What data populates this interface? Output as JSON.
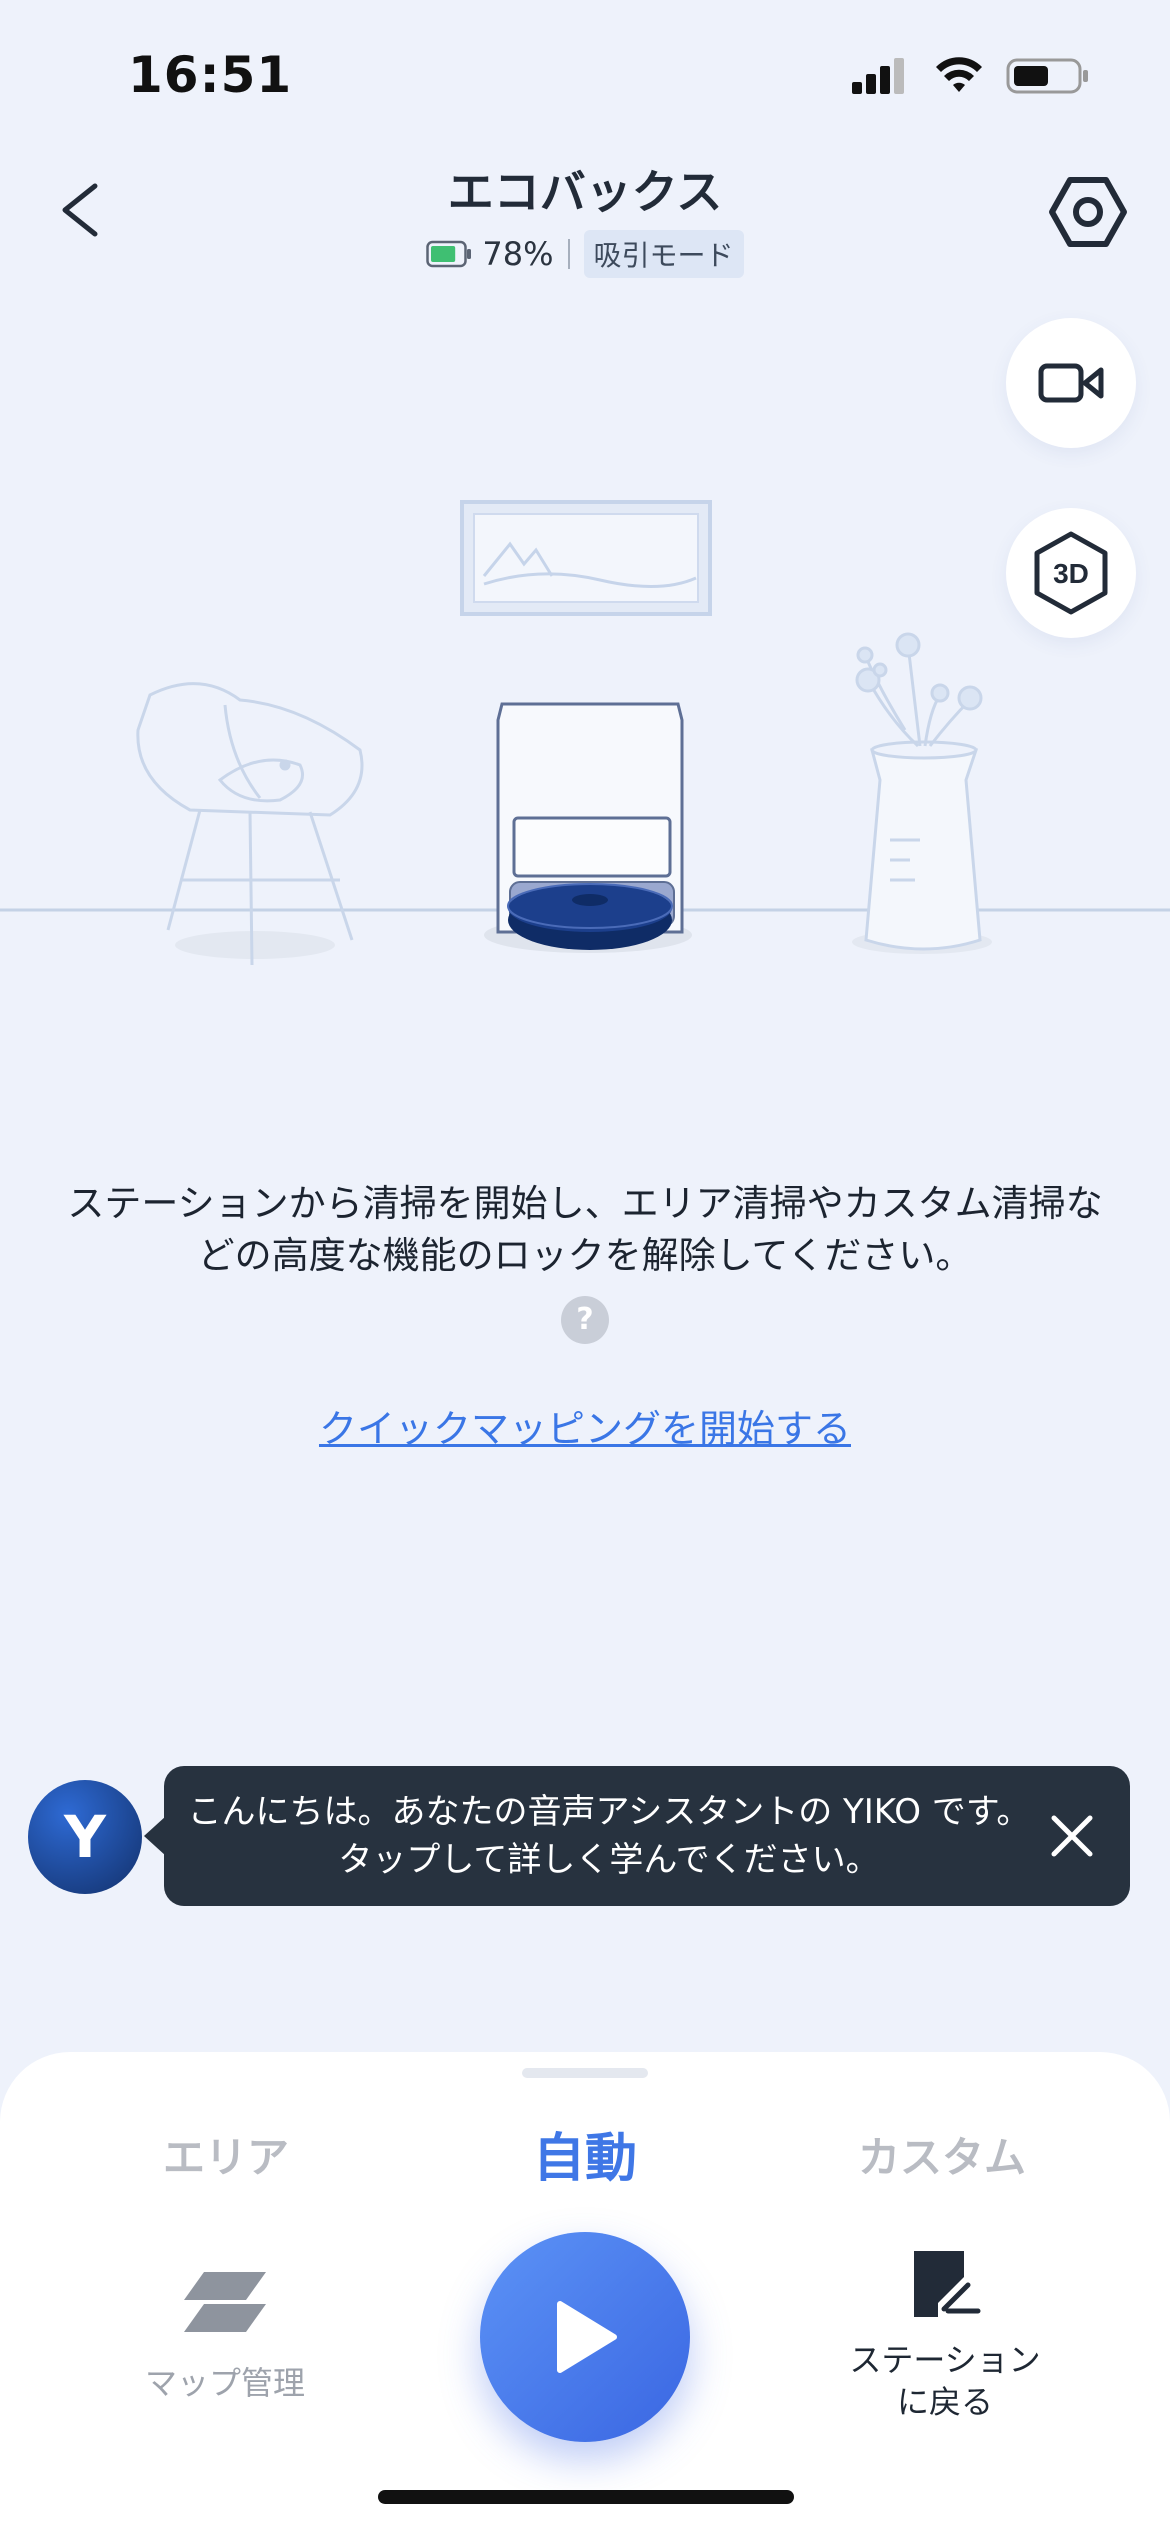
{
  "status_bar": {
    "time": "16:51"
  },
  "header": {
    "title": "エコバックス",
    "battery_percent": "78%",
    "mode": "吸引モード",
    "battery_level": 0.78
  },
  "floating_buttons": {
    "view_3d_label": "3D"
  },
  "description": "ステーションから清掃を開始し、エリア清掃やカスタム清掃などの高度な機能のロックを解除してください。",
  "help_icon_label": "?",
  "quick_mapping_link": "クイックマッピングを開始する",
  "assistant": {
    "avatar_letter": "Y",
    "message": "こんにちは。あなたの音声アシスタントの YIKO です。タップして詳しく学んでください。"
  },
  "bottom_panel": {
    "tabs": [
      {
        "label": "エリア",
        "active": false
      },
      {
        "label": "自動",
        "active": true
      },
      {
        "label": "カスタム",
        "active": false
      }
    ],
    "map_management_label": "マップ管理",
    "return_to_station_label": "ステーション\nに戻る"
  },
  "colors": {
    "accent": "#3f77e6",
    "background": "#eef2fb",
    "bubble": "#27323f"
  }
}
